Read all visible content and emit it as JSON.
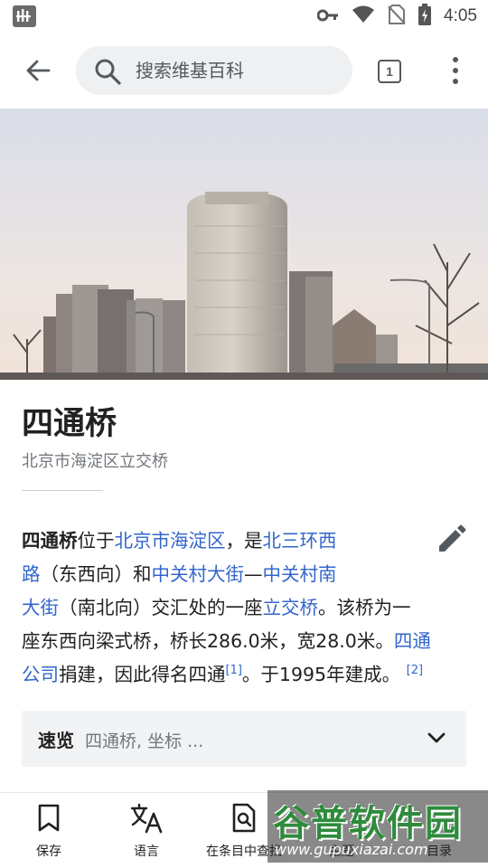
{
  "status_bar": {
    "time": "4:05"
  },
  "toolbar": {
    "search_placeholder": "搜索维基百科",
    "tab_count": "1"
  },
  "article": {
    "title": "四通桥",
    "subtitle": "北京市海淀区立交桥",
    "body": {
      "l1_bold": "四通桥",
      "l1_t1": "位于",
      "l1_link1": "北京市海淀区",
      "l1_t2": "，是",
      "l1_link2": "北三环西",
      "l2_link2b": "路",
      "l2_t1": "（东西向）和",
      "l2_link3": "中关村大街",
      "l2_t2": "—",
      "l2_link4": "中关村南",
      "l3_link4b": "大街",
      "l3_t1": "（南北向）交汇处的一座",
      "l3_link5": "立交桥",
      "l3_t2": "。该桥为一",
      "l4_t1": "座东西向梁式桥，桥长286.0米，宽28.0米。",
      "l4_link6": "四通",
      "l5_link6b": "公司",
      "l5_t1": "捐建，因此得名四通",
      "l5_ref1": "[1]",
      "l5_t2": "。于1995年建成。",
      "l5_ref2": "[2]"
    },
    "quick_facts": {
      "label": "速览",
      "summary": "四通桥, 坐标 ..."
    }
  },
  "bottom_bar": {
    "items": [
      {
        "label": "保存",
        "icon": "bookmark-icon"
      },
      {
        "label": "语言",
        "icon": "translate-icon"
      },
      {
        "label": "在条目中查找",
        "icon": "find-in-page-icon"
      },
      {
        "label": "主题",
        "icon": "theme-icon"
      },
      {
        "label": "目录",
        "icon": "contents-icon"
      }
    ]
  },
  "watermark": {
    "title": "谷普软件园",
    "url": "www.gupuxiazai.com"
  },
  "colors": {
    "link": "#3366cc",
    "text": "#202122",
    "muted": "#72777d"
  }
}
